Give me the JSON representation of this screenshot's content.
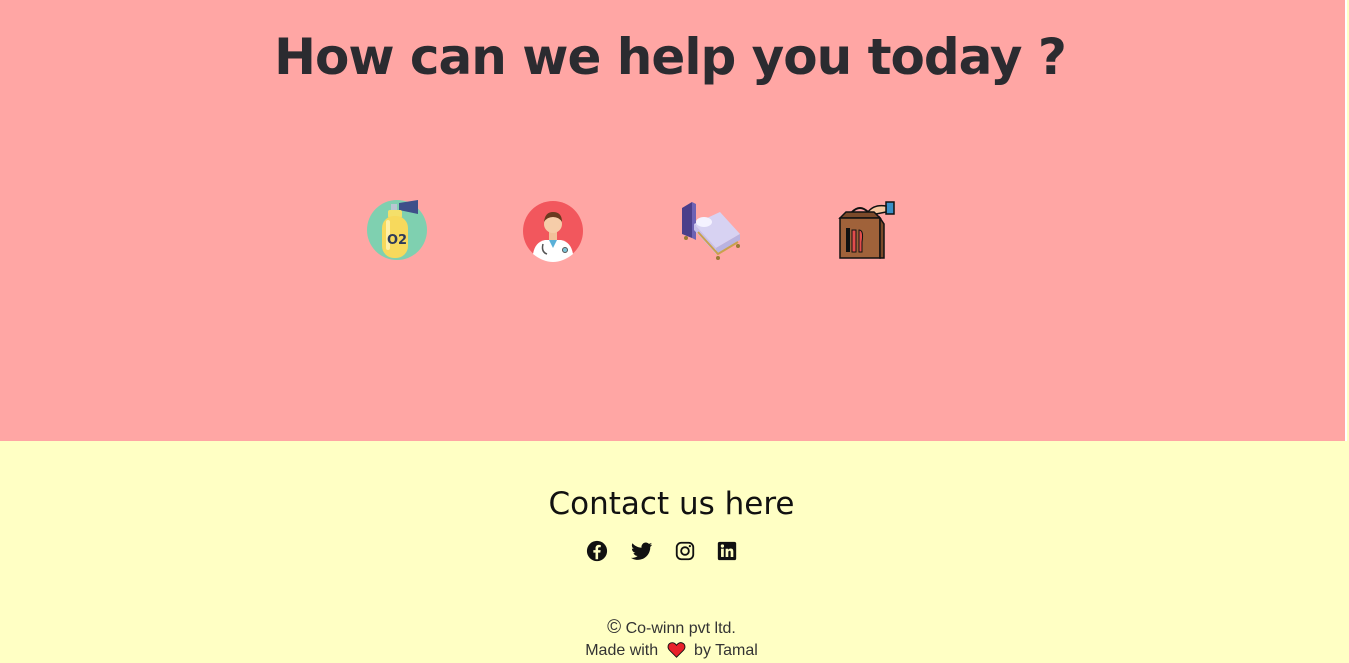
{
  "help": {
    "title": "How can we help you today ?",
    "services": [
      {
        "icon": "oxygen-cylinder-icon",
        "label": "O2"
      },
      {
        "icon": "doctor-icon"
      },
      {
        "icon": "hospital-bed-icon"
      },
      {
        "icon": "food-delivery-icon"
      }
    ]
  },
  "contact": {
    "title": "Contact us here",
    "social": [
      "facebook-icon",
      "twitter-icon",
      "instagram-icon",
      "linkedin-icon"
    ]
  },
  "footer": {
    "copyright_symbol": "©",
    "copyright": "Co-winn pvt ltd.",
    "made_with": "Made with",
    "by": "by Tamal"
  },
  "colors": {
    "help_bg": "#ffa6a4",
    "contact_bg": "#ffffc4",
    "heart": "#e8202a"
  }
}
